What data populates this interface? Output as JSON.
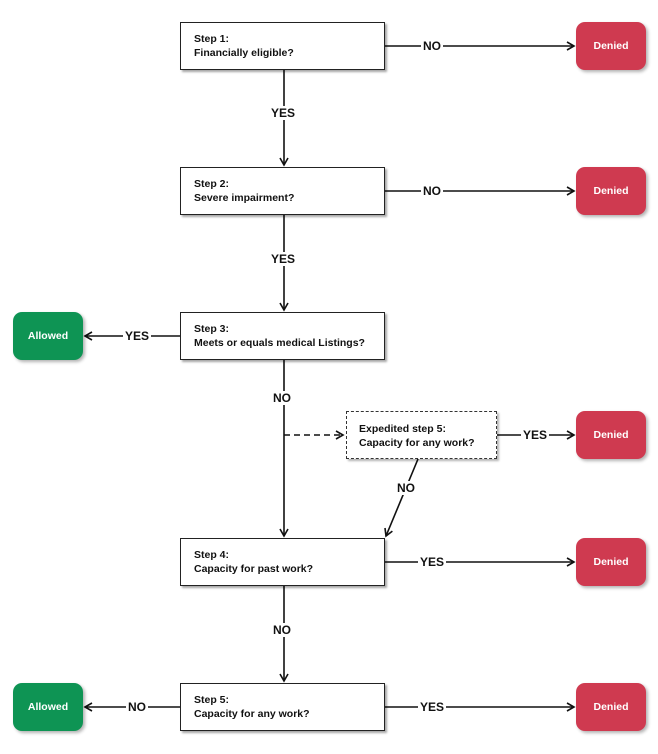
{
  "colors": {
    "denied": "#cf3a50",
    "allowed": "#0e9454",
    "line": "#111111"
  },
  "steps": [
    {
      "title": "Step 1:",
      "question": "Financially eligible?"
    },
    {
      "title": "Step 2:",
      "question": "Severe impairment?"
    },
    {
      "title": "Step 3:",
      "question": "Meets or equals medical Listings?"
    },
    {
      "title": "Step 4:",
      "question": "Capacity for past work?"
    },
    {
      "title": "Step 5:",
      "question": "Capacity for any work?"
    }
  ],
  "expedited": {
    "title": "Expedited step 5:",
    "question": "Capacity for any work?"
  },
  "outcomes": {
    "denied": "Denied",
    "allowed": "Allowed"
  },
  "edges": {
    "s1_no": "NO",
    "s1_yes": "YES",
    "s2_no": "NO",
    "s2_yes": "YES",
    "s3_yes": "YES",
    "s3_no": "NO",
    "exp_yes": "YES",
    "exp_no": "NO",
    "s4_yes": "YES",
    "s4_no": "NO",
    "s5_yes": "YES",
    "s5_no": "NO"
  }
}
